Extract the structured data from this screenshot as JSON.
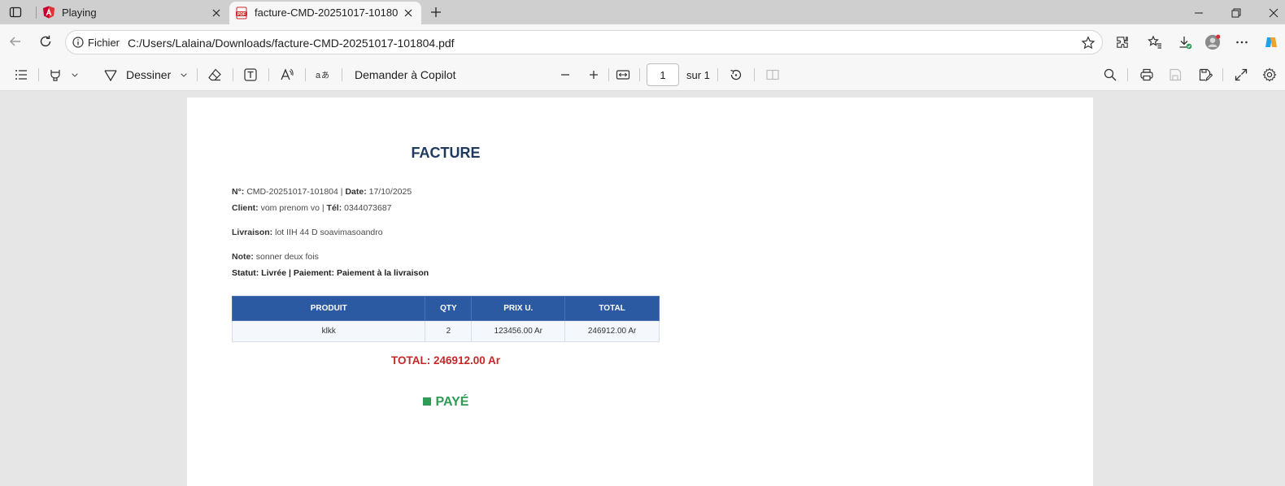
{
  "browser": {
    "tabs": [
      {
        "title": "Playing",
        "icon": "angular-icon"
      },
      {
        "title": "facture-CMD-20251017-101804.pdf",
        "icon": "pdf-icon"
      }
    ],
    "address": {
      "scheme_label": "Fichier",
      "url": "C:/Users/Lalaina/Downloads/facture-CMD-20251017-101804.pdf"
    }
  },
  "pdf_toolbar": {
    "draw_label": "Dessiner",
    "copilot_label": "Demander à Copilot",
    "page_number": "1",
    "page_total": "sur 1"
  },
  "invoice": {
    "title": "FACTURE",
    "number_label": "N°:",
    "number": "CMD-20251017-101804",
    "date_label": "Date:",
    "date": "17/10/2025",
    "client_label": "Client:",
    "client": "vom prenom vo",
    "tel_label": "Tél:",
    "tel": "0344073687",
    "delivery_label": "Livraison:",
    "delivery": "lot IIH 44 D soavimasoandro",
    "note_label": "Note:",
    "note": "sonner deux fois",
    "status_line": "Statut: Livrée | Paiement: Paiement à la livraison",
    "table": {
      "headers": [
        "PRODUIT",
        "QTY",
        "PRIX U.",
        "TOTAL"
      ],
      "rows": [
        [
          "klkk",
          "2",
          "123456.00 Ar",
          "246912.00 Ar"
        ]
      ]
    },
    "total_line": "TOTAL: 246912.00 Ar",
    "paid_label": "PAYÉ",
    "colors": {
      "title": "#1e3a5f",
      "header": "#2b5aa3",
      "total": "#c62828",
      "paid": "#2e9b57"
    }
  }
}
